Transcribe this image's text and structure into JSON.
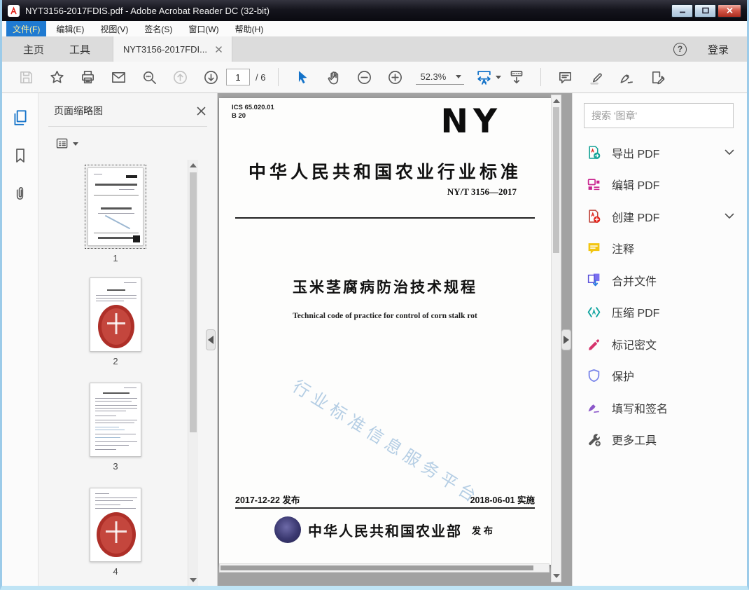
{
  "window": {
    "title": "NYT3156-2017FDIS.pdf - Adobe Acrobat Reader DC (32-bit)"
  },
  "menu": {
    "items": [
      "文件(F)",
      "编辑(E)",
      "视图(V)",
      "签名(S)",
      "窗口(W)",
      "帮助(H)"
    ]
  },
  "tabs": {
    "home": "主页",
    "tools": "工具",
    "document": "NYT3156-2017FDI...",
    "help_glyph": "?",
    "sign_in": "登录"
  },
  "toolbar": {
    "page_current": "1",
    "page_total": "/ 6",
    "zoom_level": "52.3%"
  },
  "left_panel": {
    "title": "页面缩略图",
    "page_labels": [
      "1",
      "2",
      "3",
      "4"
    ]
  },
  "document": {
    "ics_line1": "ICS 65.020.01",
    "ics_line2": "B 20",
    "logo": "NY",
    "standard_heading": "中华人民共和国农业行业标准",
    "standard_number": "NY/T 3156—2017",
    "title_cn": "玉米茎腐病防治技术规程",
    "title_en": "Technical code of practice for control of corn stalk rot",
    "watermark": "行业标准信息服务平台",
    "issue_date": "2017-12-22 发布",
    "impl_date": "2018-06-01 实施",
    "publisher": "中华人民共和国农业部",
    "publish_label": "发布"
  },
  "right_panel": {
    "search_placeholder": "搜索 '图章'",
    "tools": [
      {
        "label": "导出 PDF",
        "expandable": true
      },
      {
        "label": "编辑 PDF",
        "expandable": false
      },
      {
        "label": "创建 PDF",
        "expandable": true
      },
      {
        "label": "注释",
        "expandable": false
      },
      {
        "label": "合并文件",
        "expandable": false
      },
      {
        "label": "压缩 PDF",
        "expandable": false
      },
      {
        "label": "标记密文",
        "expandable": false
      },
      {
        "label": "保护",
        "expandable": false
      },
      {
        "label": "填写和签名",
        "expandable": false
      },
      {
        "label": "更多工具",
        "expandable": false
      }
    ]
  },
  "colors": {
    "accent_blue": "#1473c9",
    "menu_highlight": "#1f7ad1",
    "menu_highlight_text": "#ffef9e",
    "close_button_red": "#ad2d1f",
    "watermark_blue": "#a9c6e0",
    "seal_red": "#ae2f28",
    "doc_area_gray": "#a2a2a2"
  }
}
